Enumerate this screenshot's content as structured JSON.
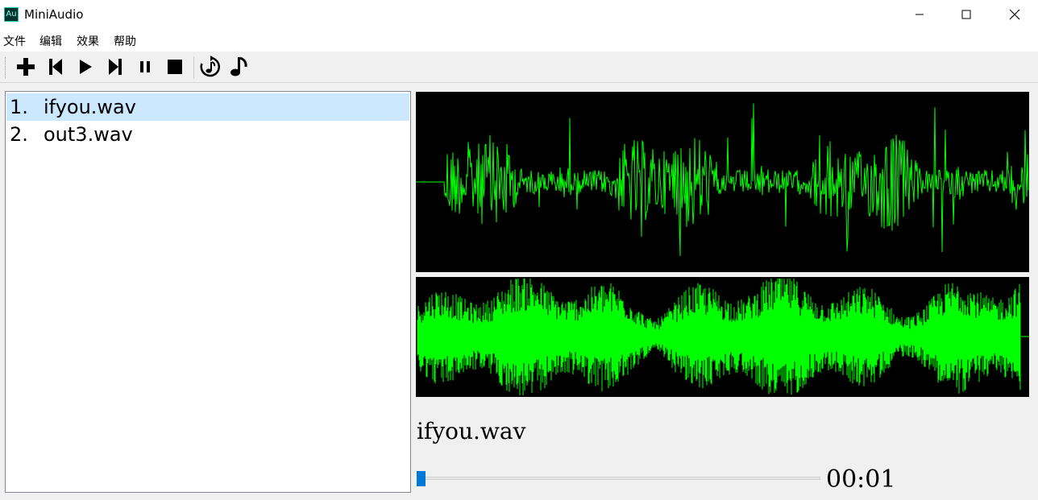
{
  "window": {
    "title": "MiniAudio",
    "app_icon_text": "Au"
  },
  "menu": [
    {
      "label": "文件"
    },
    {
      "label": "编辑"
    },
    {
      "label": "效果"
    },
    {
      "label": "帮助"
    }
  ],
  "toolbar": {
    "buttons": [
      "add-icon",
      "previous-icon",
      "play-icon",
      "next-icon",
      "pause-icon",
      "stop-icon",
      "loop-icon",
      "music-note-icon"
    ]
  },
  "playlist": {
    "items": [
      {
        "number": "1.",
        "name": "ifyou.wav",
        "selected": true
      },
      {
        "number": "2.",
        "name": "out3.wav",
        "selected": false
      }
    ]
  },
  "player": {
    "current_file": "ifyou.wav",
    "time": "00:01",
    "seek_position": 0.0,
    "waveform_color": "#00ff00",
    "waveform_background": "#000000"
  },
  "colors": {
    "accent": "#0078d7",
    "selection": "#cce8ff"
  }
}
